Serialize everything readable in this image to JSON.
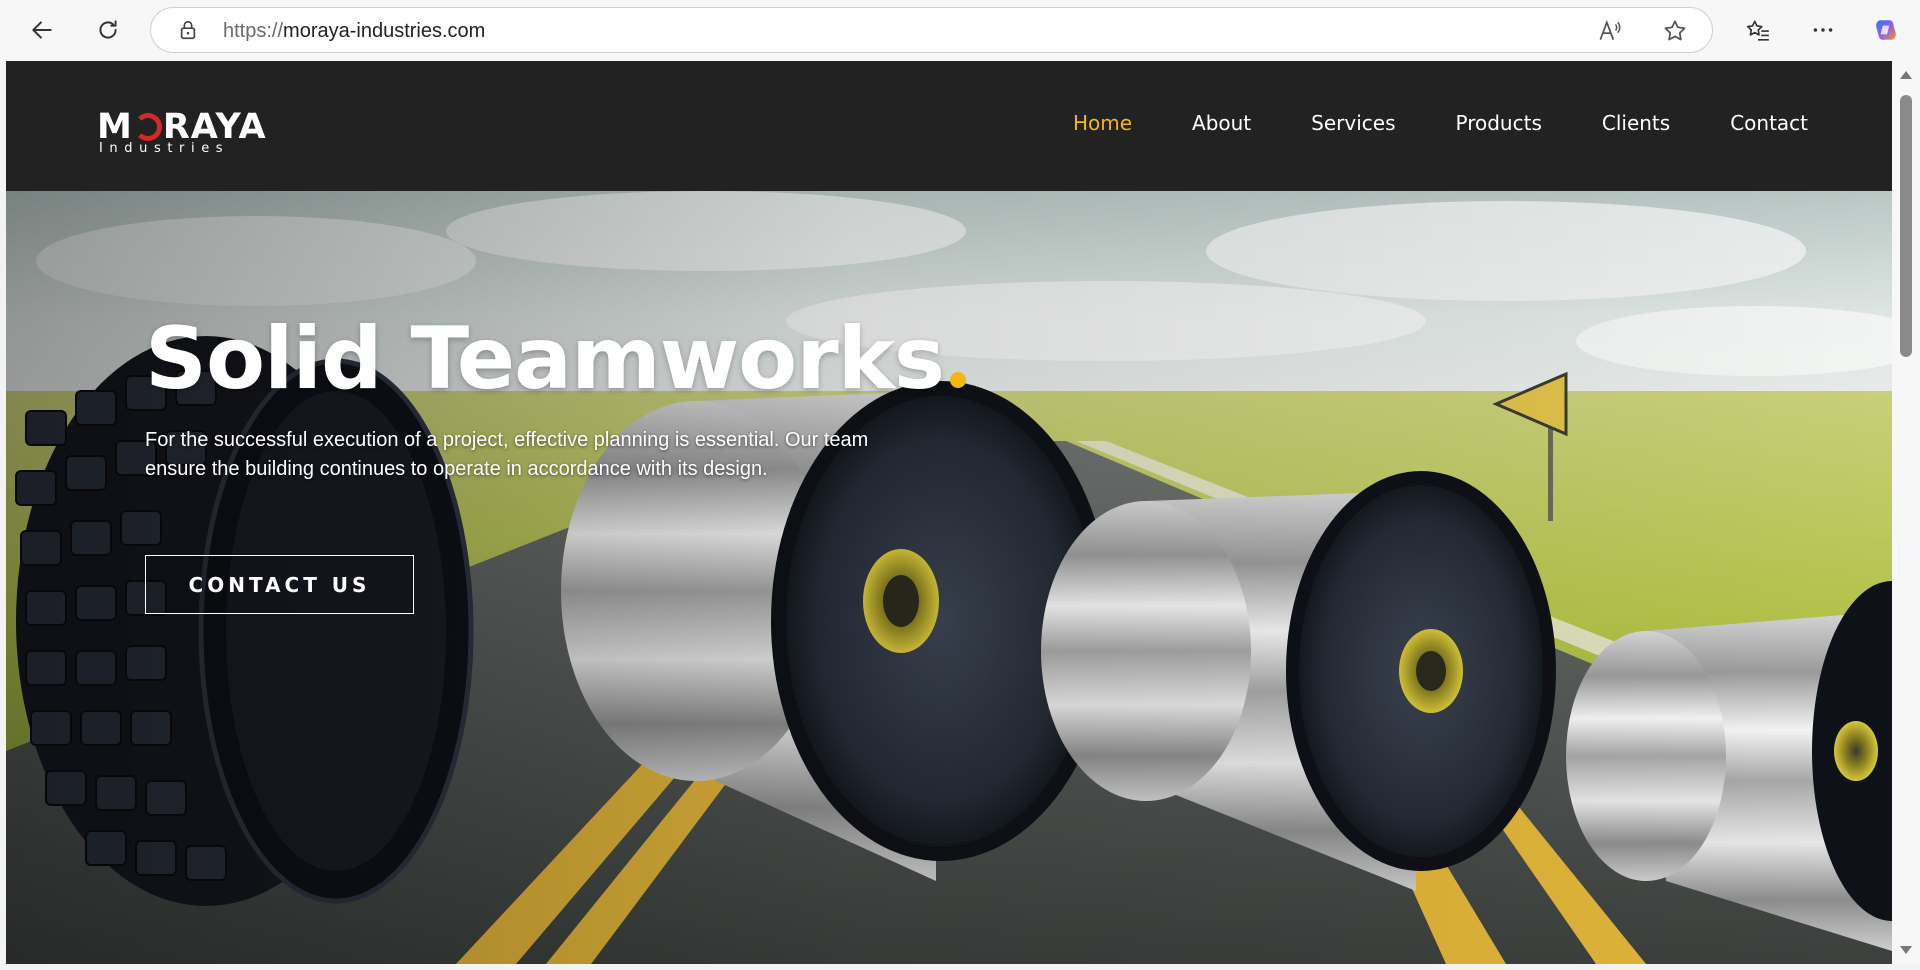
{
  "browser": {
    "url_protocol": "https://",
    "url_host": "moraya-industries.com"
  },
  "site": {
    "logo_main_left": "M",
    "logo_main_right": "RAYA",
    "logo_sub": "Industries",
    "nav": [
      {
        "label": "Home",
        "active": true
      },
      {
        "label": "About",
        "active": false
      },
      {
        "label": "Services",
        "active": false
      },
      {
        "label": "Products",
        "active": false
      },
      {
        "label": "Clients",
        "active": false
      },
      {
        "label": "Contact",
        "active": false
      }
    ],
    "accent_color": "#f2b619",
    "header_bg": "#222222"
  },
  "hero": {
    "title": "Solid Teamworks",
    "description": "For the successful execution of a project, effective planning is essential. Our team ensure the building continues to operate in accordance with its design.",
    "cta_label": "CONTACT US"
  }
}
